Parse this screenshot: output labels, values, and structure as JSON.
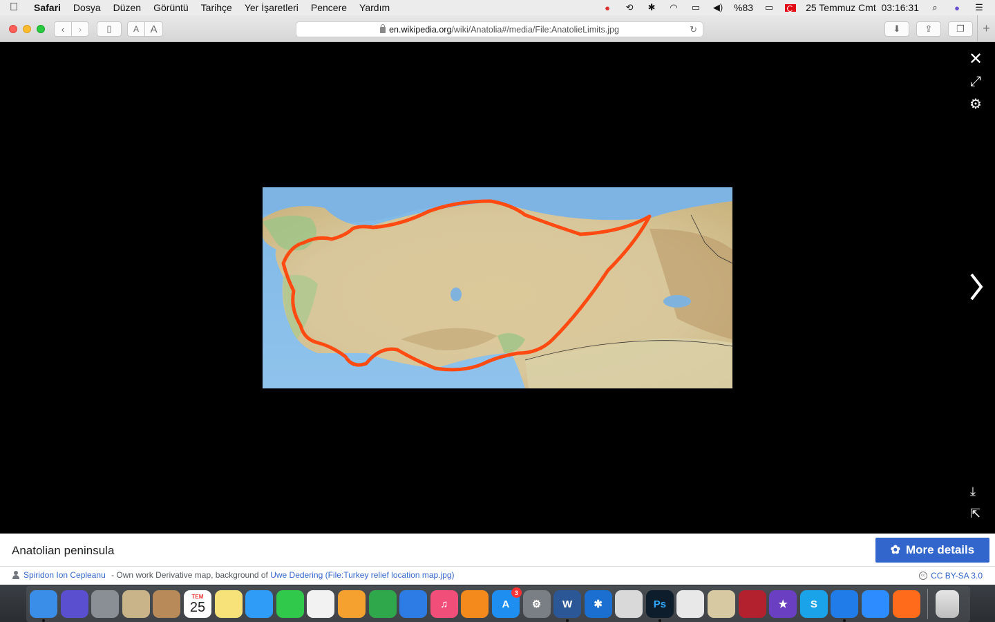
{
  "menubar": {
    "app": "Safari",
    "items": [
      "Dosya",
      "Düzen",
      "Görüntü",
      "Tarihçe",
      "Yer İşaretleri",
      "Pencere",
      "Yardım"
    ],
    "battery": "%83",
    "datetime": "25 Temmuz Cmt  03:16:31"
  },
  "toolbar": {
    "url_host": "en.wikipedia.org",
    "url_path": "/wiki/Anatolia#/media/File:AnatolieLimits.jpg",
    "font_small": "A",
    "font_large": "A"
  },
  "viewer": {
    "close_glyph": "✕",
    "expand_glyph": "⤢",
    "gear_glyph": "⚙",
    "download_glyph": "⤓",
    "share_glyph": "⇱"
  },
  "caption": {
    "title": "Anatolian peninsula",
    "more_details": "More details",
    "author": "Spiridon Ion Cepleanu",
    "desc": " - Own work Derivative map, background of ",
    "source": "Uwe Dedering (File:Turkey relief location map.jpg)",
    "license": "CC BY-SA 3.0"
  },
  "dock": {
    "calendar_month": "TEM",
    "calendar_day": "25",
    "appstore_badge": "3",
    "items": [
      {
        "name": "finder",
        "label": "",
        "color": "#3b8ee8"
      },
      {
        "name": "siri",
        "label": "",
        "color": "#5a4fcf"
      },
      {
        "name": "launchpad",
        "label": "",
        "color": "#8a8f96"
      },
      {
        "name": "mail",
        "label": "",
        "color": "#c9b48a"
      },
      {
        "name": "contacts",
        "label": "",
        "color": "#b88a5a"
      },
      {
        "name": "calendar",
        "label": "",
        "color": "#ffffff"
      },
      {
        "name": "notes",
        "label": "",
        "color": "#f7e27a"
      },
      {
        "name": "messages",
        "label": "",
        "color": "#2f9df7"
      },
      {
        "name": "facetime",
        "label": "",
        "color": "#30c94c"
      },
      {
        "name": "photos",
        "label": "",
        "color": "#f2f2f2"
      },
      {
        "name": "pages",
        "label": "",
        "color": "#f4a12f"
      },
      {
        "name": "numbers",
        "label": "",
        "color": "#2ea84b"
      },
      {
        "name": "keynote",
        "label": "",
        "color": "#2d7ce5"
      },
      {
        "name": "itunes",
        "label": "♫",
        "color": "#f24e7a"
      },
      {
        "name": "books",
        "label": "",
        "color": "#f48a1c"
      },
      {
        "name": "appstore",
        "label": "A",
        "color": "#1e8ef0"
      },
      {
        "name": "system-preferences",
        "label": "⚙",
        "color": "#7a7f85"
      },
      {
        "name": "word",
        "label": "W",
        "color": "#2b5797"
      },
      {
        "name": "bluetooth",
        "label": "✱",
        "color": "#1a6fd1"
      },
      {
        "name": "scanner",
        "label": "",
        "color": "#d9d9d9"
      },
      {
        "name": "photoshop",
        "label": "Ps",
        "color": "#0e1d2b"
      },
      {
        "name": "disk-utility",
        "label": "",
        "color": "#e8e8e8"
      },
      {
        "name": "preview",
        "label": "",
        "color": "#d7c9a1"
      },
      {
        "name": "photo-booth",
        "label": "",
        "color": "#b3212e"
      },
      {
        "name": "imovie",
        "label": "★",
        "color": "#6b3fc2"
      },
      {
        "name": "skype",
        "label": "S",
        "color": "#1aa3e8"
      },
      {
        "name": "safari",
        "label": "",
        "color": "#1f7ce8"
      },
      {
        "name": "zoom",
        "label": "",
        "color": "#2d8cff"
      },
      {
        "name": "firefox",
        "label": "",
        "color": "#ff6b1a"
      }
    ]
  }
}
